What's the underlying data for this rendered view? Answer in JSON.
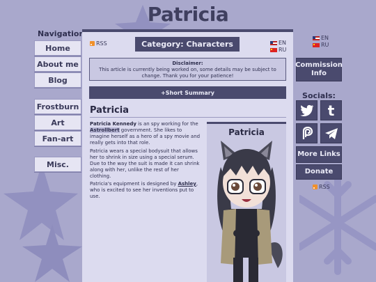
{
  "site": {
    "title": "Patricia"
  },
  "nav": {
    "heading": "Navigation:",
    "items": [
      "Home",
      "About me",
      "Blog",
      "Frostburn",
      "Art",
      "Fan-art",
      "Misc."
    ]
  },
  "header": {
    "rss": "RSS",
    "category": "Category: Characters",
    "languages": [
      "EN",
      "RU"
    ]
  },
  "disclaimer": {
    "title": "Disclaimer:",
    "text": "This article is currently being worked on, some details may be subject to change. Thank you for your patience!"
  },
  "summary_button": "+Short Summary",
  "article": {
    "title": "Patricia",
    "p1_name": "Patricia Kennedy",
    "p1_a": " is an spy working for the ",
    "p1_org": "Astrollbert",
    "p1_b": " government. She likes to imagine herself as a hero of a spy movie and really gets into that role.",
    "p2": "Patricia wears a special bodysuit that allows her to shrink in size using a special serum. Due to the way the suit is made it can shrink along with her, unlike the rest of her clothing.",
    "p3_a": "Patricia's equipment is designed by ",
    "p3_link": "Ashley",
    "p3_b": ", who is excited to see her inventions put to use."
  },
  "infobox": {
    "title": "Patricia"
  },
  "right": {
    "commission": "Commission Info",
    "socials_heading": "Socials:",
    "social_icons": [
      "twitter-icon",
      "tumblr-icon",
      "pillowfort-icon",
      "telegram-icon"
    ],
    "more_links": "More Links",
    "donate": "Donate",
    "rss": "RSS",
    "languages": [
      "EN",
      "RU"
    ]
  },
  "colors": {
    "background": "#a9a8cc",
    "panel": "#dcdbef",
    "accent": "#4a4a6e",
    "button_light": "#e6e5f3"
  }
}
